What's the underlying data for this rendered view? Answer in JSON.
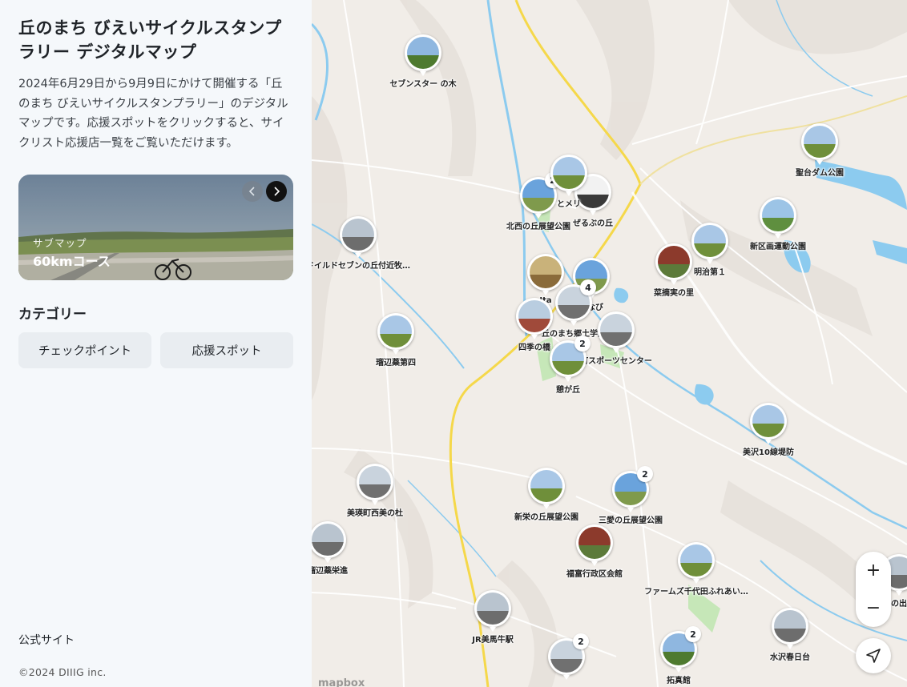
{
  "sidebar": {
    "title": "丘のまち びえいサイクルスタンプラリー デジタルマップ",
    "description": "2024年6月29日から9月9日にかけて開催する「丘のまち びえいサイクルスタンプラリー」のデジタルマップです。応援スポットをクリックすると、サイクリスト応援店一覧をご覧いただけます。",
    "card": {
      "sub_label": "サブマップ",
      "name": "60kmコース"
    },
    "category_heading": "カテゴリー",
    "categories": [
      "チェックポイント",
      "応援スポット"
    ],
    "official_link": "公式サイト",
    "copyright": "©2024 DIIIG inc."
  },
  "map": {
    "markers": [
      {
        "label": "セブンスター の木",
        "badge": "",
        "tone": "tree"
      },
      {
        "label": "聖台ダム公園",
        "badge": "",
        "tone": "field"
      },
      {
        "label": "北西の丘展望公園",
        "badge": "2",
        "tone": "sky"
      },
      {
        "label": "ぜるぶの丘",
        "badge": "",
        "tone": "sign"
      },
      {
        "label": "とメリ",
        "badge": "",
        "tone": "field"
      },
      {
        "label": "ドイルドセブンの丘付近牧…",
        "badge": "",
        "tone": "road"
      },
      {
        "label": "新区画運動公園",
        "badge": "",
        "tone": "park"
      },
      {
        "label": "明治第１",
        "badge": "",
        "tone": "field"
      },
      {
        "label": "菜摘実の里",
        "badge": "",
        "tone": "house"
      },
      {
        "label": "Ita",
        "badge": "",
        "tone": "food"
      },
      {
        "label": "はなび",
        "badge": "",
        "tone": "sky"
      },
      {
        "label": "丘のまち郷土学館",
        "badge": "4",
        "tone": "building"
      },
      {
        "label": "四季の橋",
        "badge": "",
        "tone": "bridge"
      },
      {
        "label": "町スポーツセンター",
        "badge": "",
        "tone": "building"
      },
      {
        "label": "憩が丘",
        "badge": "2",
        "tone": "field"
      },
      {
        "label": "瑠辺蘂第四",
        "badge": "",
        "tone": "field"
      },
      {
        "label": "美沢10線堤防",
        "badge": "",
        "tone": "field"
      },
      {
        "label": "美瑛町西美の杜",
        "badge": "",
        "tone": "building"
      },
      {
        "label": "新栄の丘展望公園",
        "badge": "",
        "tone": "field"
      },
      {
        "label": "三愛の丘展望公園",
        "badge": "2",
        "tone": "sky"
      },
      {
        "label": "瑠辺蘂栄進",
        "badge": "",
        "tone": "road"
      },
      {
        "label": "福富行政区会館",
        "badge": "",
        "tone": "house"
      },
      {
        "label": "ファームズ千代田ふれあい…",
        "badge": "",
        "tone": "field"
      },
      {
        "label": "の出",
        "badge": "",
        "tone": "road"
      },
      {
        "label": "JR美馬牛駅",
        "badge": "",
        "tone": "road"
      },
      {
        "label": "水沢春日台",
        "badge": "",
        "tone": "road"
      },
      {
        "label": "",
        "badge": "2",
        "tone": "building"
      },
      {
        "label": "拓真館",
        "badge": "2",
        "tone": "tree"
      }
    ],
    "zoom_in": "+",
    "zoom_out": "−",
    "attribution": "mapbox",
    "colors": {
      "water": "#8ccbef",
      "road_main": "#f5d84a",
      "road": "#ffffff",
      "land": "#f1ede8",
      "park": "#b7e2a9"
    }
  }
}
